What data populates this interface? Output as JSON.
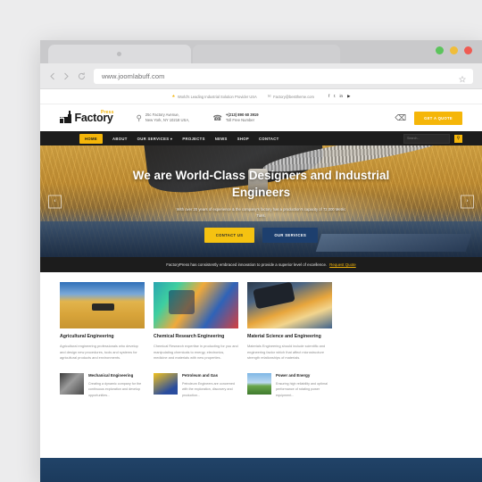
{
  "browser": {
    "url": "www.joomlabuff.com",
    "back_icon": "chevron-left-icon",
    "forward_icon": "chevron-right-icon",
    "reload_icon": "reload-icon",
    "bookmark_icon": "star-icon",
    "dots": [
      "#5cc45c",
      "#f0bd3a",
      "#ef5b52"
    ]
  },
  "topbar": {
    "tagline": "World's Leading Industrial Solution Provider USA",
    "email": "Factory@besttheme.com",
    "email_icon": "envelope-icon",
    "tag_icon": "tag-icon",
    "social": [
      "f",
      "t",
      "in",
      "▶"
    ]
  },
  "header": {
    "logo_text": "Factory",
    "logo_super": "Press",
    "address_icon": "map-pin-icon",
    "address_line1": "25c Factory Avenue,",
    "address_line2": "New York, NY 10218 USA,",
    "phone_icon": "phone-icon",
    "phone_line1": "+(213) 890 60 3919",
    "phone_line2": "Toll Free Number",
    "cart_icon": "cart-icon",
    "quote_label": "GET A QUOTE"
  },
  "nav": {
    "items": [
      {
        "label": "HOME",
        "active": true
      },
      {
        "label": "ABOUT",
        "active": false
      },
      {
        "label": "OUR SERVICES",
        "active": false,
        "caret": true
      },
      {
        "label": "PROJECTS",
        "active": false
      },
      {
        "label": "NEWS",
        "active": false
      },
      {
        "label": "SHOP",
        "active": false
      },
      {
        "label": "CONTACT",
        "active": false
      }
    ],
    "search_placeholder": "Search...",
    "search_icon": "search-icon"
  },
  "hero": {
    "heading": "We are World-Class Designers and Industrial Engineers",
    "subtext": "With over 20 years of experience & the company's factory has a production's capacity of 72,000 Metric Tuns.",
    "btn_primary": "CONTACT US",
    "btn_secondary": "OUR SERVICES",
    "prev_icon": "chevron-left-icon",
    "next_icon": "chevron-right-icon",
    "prev_glyph": "‹",
    "next_glyph": "›"
  },
  "notice": {
    "text": "FactoryPress has consistently embraced innovation to provide a superior level of excellence.",
    "link": "Request Quote"
  },
  "cards_top": [
    {
      "title": "Agricultural Engineering",
      "body": "Agricultural engineering professionals who develop and design new procedures, tools and systems for agricultural products and environments.",
      "image": "wheat-harvester-image"
    },
    {
      "title": "Chemical Research Engineering",
      "body": "Chemical Research expertise in producting for you and manipulating chemicals to energy, electronics, medicine and materials with new properties.",
      "image": "chemistry-lab-image"
    },
    {
      "title": "Material Science and Engineering",
      "body": "Materials Engineering should include scientific and engineering factor which that affect microstructure strength relationships of materials.",
      "image": "laser-cutting-image"
    }
  ],
  "cards_bottom": [
    {
      "title": "Mechanical Engineering",
      "body": "Creating a dynamic company for the continuous exploration and develop opportunities...",
      "image": "gears-workers-image"
    },
    {
      "title": "Petroleum and Gas",
      "body": "Petroleum Engineers are concerned with the exploration, discovery and production...",
      "image": "petroleum-refinery-image"
    },
    {
      "title": "Power and Energy",
      "body": "Ensuring high reliability and optimal performance of rotating power equipment...",
      "image": "power-field-image"
    }
  ],
  "colors": {
    "accent_yellow": "#f5b609",
    "dark_nav": "#1c1c1c",
    "footer_blue": "#214368",
    "hero_btn_blue": "#1d3f6e"
  }
}
